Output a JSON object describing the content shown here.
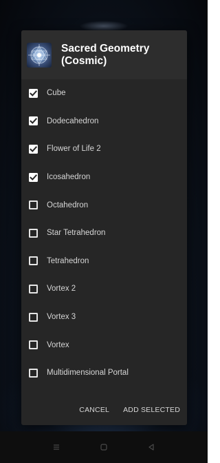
{
  "dialog": {
    "title": "Sacred Geometry (Cosmic)",
    "icon": "sacred-geometry-icon",
    "items": [
      {
        "label": "Cube",
        "checked": true
      },
      {
        "label": "Dodecahedron",
        "checked": true
      },
      {
        "label": "Flower of Life 2",
        "checked": true
      },
      {
        "label": "Icosahedron",
        "checked": true
      },
      {
        "label": "Octahedron",
        "checked": false
      },
      {
        "label": "Star Tetrahedron",
        "checked": false
      },
      {
        "label": "Tetrahedron",
        "checked": false
      },
      {
        "label": "Vortex 2",
        "checked": false
      },
      {
        "label": "Vortex 3",
        "checked": false
      },
      {
        "label": "Vortex",
        "checked": false
      },
      {
        "label": "Multidimensional Portal",
        "checked": false
      }
    ],
    "actions": {
      "cancel_label": "CANCEL",
      "add_label": "ADD SELECTED"
    }
  },
  "navbar": {
    "icons": [
      "menu-icon",
      "home-icon",
      "back-icon"
    ]
  },
  "colors": {
    "dialog_bg": "#262626",
    "header_bg": "#2d2d2d",
    "text": "#d6d6d6",
    "navbar_bg": "#0e0e0e"
  }
}
